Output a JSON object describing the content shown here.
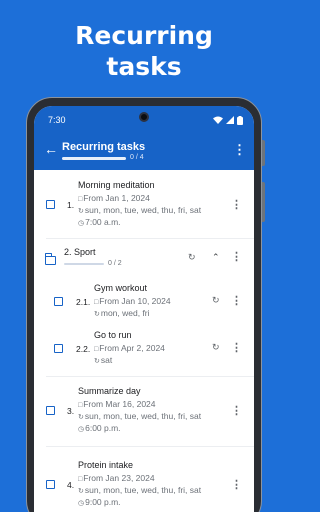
{
  "headline": [
    "Recurring",
    "tasks"
  ],
  "status_bar": {
    "time": "7:30"
  },
  "app_bar": {
    "back_icon": "arrow-back-icon",
    "title": "Recurring tasks",
    "count": "0 / 4",
    "progress_fraction": 0,
    "menu_icon": "more-vert-icon"
  },
  "tasks": [
    {
      "number": "1.",
      "title": "Morning meditation",
      "from": "From Jan 1, 2024",
      "days": "sun, mon, tue, wed, thu, fri, sat",
      "time": "7:00 a.m."
    },
    {
      "number": "2.",
      "title": "Sport",
      "count": "0 / 2",
      "is_group": true,
      "children": [
        {
          "number": "2.1.",
          "title": "Gym workout",
          "from": "From Jan 10, 2024",
          "days": "mon, wed, fri"
        },
        {
          "number": "2.2.",
          "title": "Go to run",
          "from": "From Apr 2, 2024",
          "days": "sat"
        }
      ]
    },
    {
      "number": "3.",
      "title": "Summarize day",
      "from": "From Mar 16, 2024",
      "days": "sun, mon, tue, wed, thu, fri, sat",
      "time": "6:00 p.m."
    },
    {
      "number": "4.",
      "title": "Protein intake",
      "from": "From Jan 23, 2024",
      "days": "sun, mon, tue, wed, thu, fri, sat",
      "time": "9:00 p.m."
    }
  ],
  "colors": {
    "background": "#1d6fd8",
    "app_bar": "#1763c7",
    "accent": "#1763c7"
  }
}
